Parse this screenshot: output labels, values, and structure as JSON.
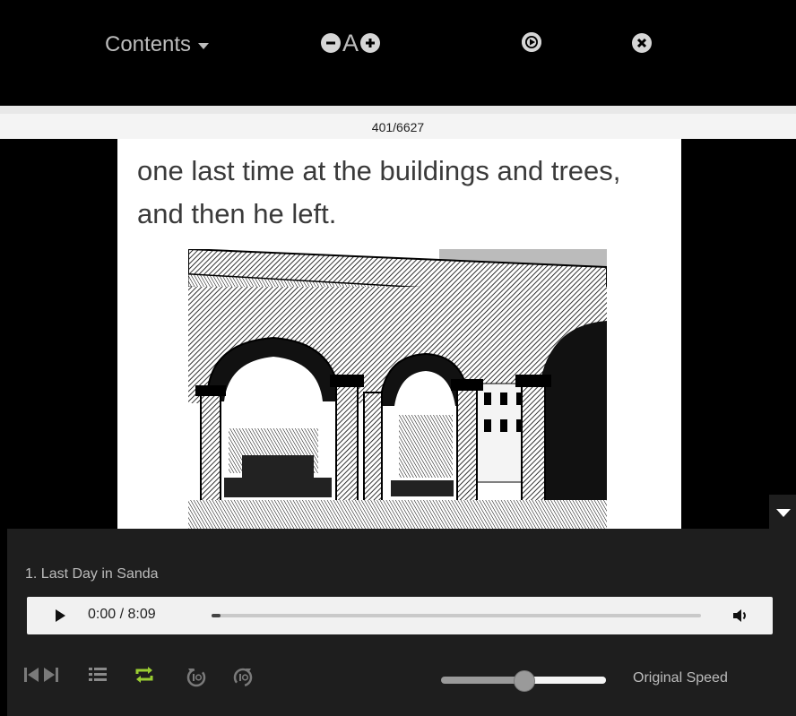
{
  "toolbar": {
    "contents_label": "Contents",
    "font_label": "A"
  },
  "reader": {
    "page_counter": "401/6627",
    "text_line1": "one last time at the buildings and trees,",
    "text_line2": "and then he left."
  },
  "audio": {
    "track_title": "1. Last Day in Sanda",
    "time_display": "0:00 / 8:09",
    "progress_fraction": 0.0,
    "speed_label": "Original Speed",
    "speed_level_fraction": 0.5
  },
  "colors": {
    "toolbar_bg": "#000000",
    "panel_bg": "#1e1e1e",
    "repeat_active": "#9acd32",
    "icon_gray": "#bdbdbd"
  },
  "icons": [
    "zoom-out-icon",
    "zoom-in-icon",
    "play-circle-icon",
    "close-icon",
    "skip-previous-icon",
    "skip-next-icon",
    "playlist-icon",
    "repeat-icon",
    "rewind-10-icon",
    "forward-10-icon",
    "volume-icon",
    "collapse-arrow-icon"
  ]
}
